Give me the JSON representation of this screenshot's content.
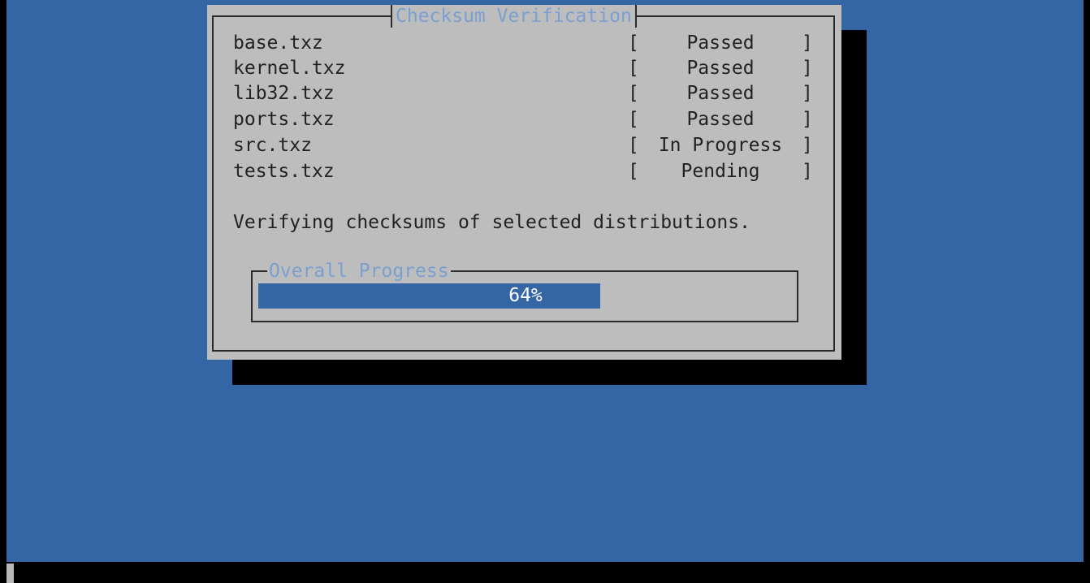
{
  "dialog": {
    "title": "Checksum Verification",
    "items": [
      {
        "name": "base.txz",
        "status": "Passed"
      },
      {
        "name": "kernel.txz",
        "status": "Passed"
      },
      {
        "name": "lib32.txz",
        "status": "Passed"
      },
      {
        "name": "ports.txz",
        "status": "Passed"
      },
      {
        "name": "src.txz",
        "status": "In Progress"
      },
      {
        "name": "tests.txz",
        "status": "Pending"
      }
    ],
    "bracket_open": "[",
    "bracket_close": "]",
    "message": "Verifying checksums of selected distributions."
  },
  "progress": {
    "label": "Overall Progress",
    "text": "64%",
    "fraction": 0.64
  },
  "colors": {
    "background": "#3465a4",
    "dialog": "#bdbdbd",
    "title_text": "#7a9fd0",
    "progress_fill": "#3465a4"
  }
}
